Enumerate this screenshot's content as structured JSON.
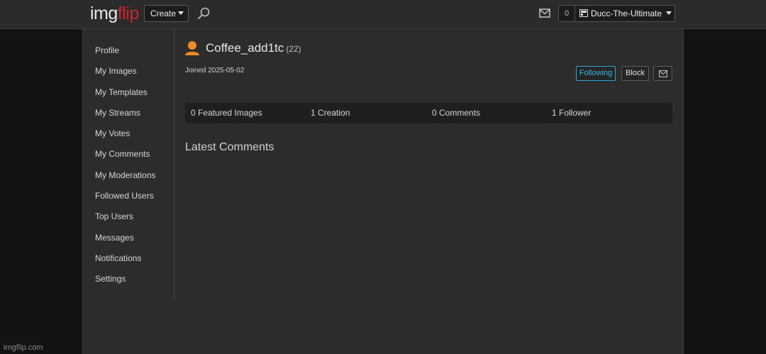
{
  "header": {
    "logo_img": "img",
    "logo_flip": "flip",
    "create_label": "Create",
    "notification_count": "0",
    "username": "Ducc-The-Ultimate"
  },
  "sidebar": {
    "items": [
      {
        "label": "Profile"
      },
      {
        "label": "My Images"
      },
      {
        "label": "My Templates"
      },
      {
        "label": "My Streams"
      },
      {
        "label": "My Votes"
      },
      {
        "label": "My Comments"
      },
      {
        "label": "My Moderations"
      },
      {
        "label": "Followed Users"
      },
      {
        "label": "Top Users"
      },
      {
        "label": "Messages"
      },
      {
        "label": "Notifications"
      },
      {
        "label": "Settings"
      }
    ]
  },
  "profile": {
    "username": "Coffee_add1tc",
    "points": "(22)",
    "joined": "Joined 2025-05-02",
    "following_label": "Following",
    "block_label": "Block"
  },
  "stats": {
    "featured": "0 Featured Images",
    "creations": "1 Creation",
    "comments": "0 Comments",
    "followers": "1 Follower"
  },
  "section": {
    "latest_comments": "Latest Comments"
  },
  "footer": {
    "brand": "imgflip.com"
  },
  "colors": {
    "accent_following": "#2aa7d6",
    "logo_red": "#c8262c",
    "user_icon": "#f08a24"
  }
}
